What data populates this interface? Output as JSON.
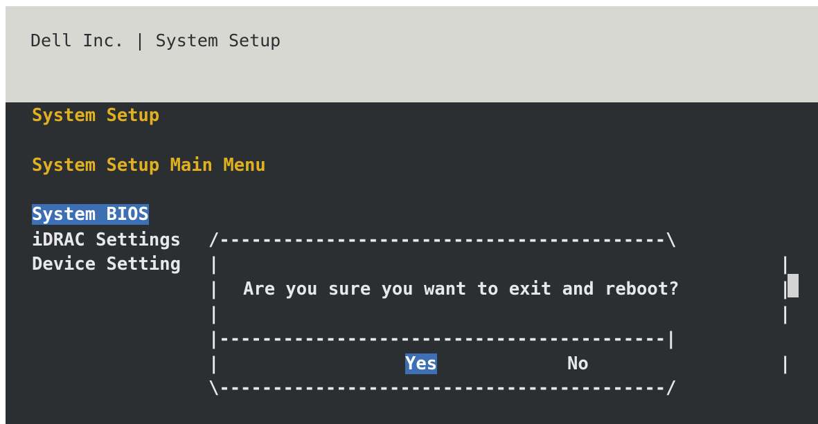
{
  "header": {
    "title": "Dell Inc. | System Setup"
  },
  "page": {
    "title": "System Setup",
    "subtitle": "System Setup Main Menu"
  },
  "menu": {
    "items": [
      {
        "label": "System BIOS",
        "selected": true
      },
      {
        "label": "iDRAC Settings"
      },
      {
        "label": "Device Setting"
      }
    ]
  },
  "dialog": {
    "border_top": "/------------------------------------------\\",
    "side": "|",
    "message": "Are you sure you want to exit and reboot?",
    "separator": "|------------------------------------------|",
    "border_bottom": "\\------------------------------------------/",
    "yes_label": "Yes",
    "no_label": "No",
    "selected_button": "yes"
  },
  "colors": {
    "header_bg": "#d8d8d2",
    "console_bg": "#2c2f32",
    "heading_text": "#e0b020",
    "body_text": "#e8e8e8",
    "selection_bg": "#3d6fb4"
  }
}
